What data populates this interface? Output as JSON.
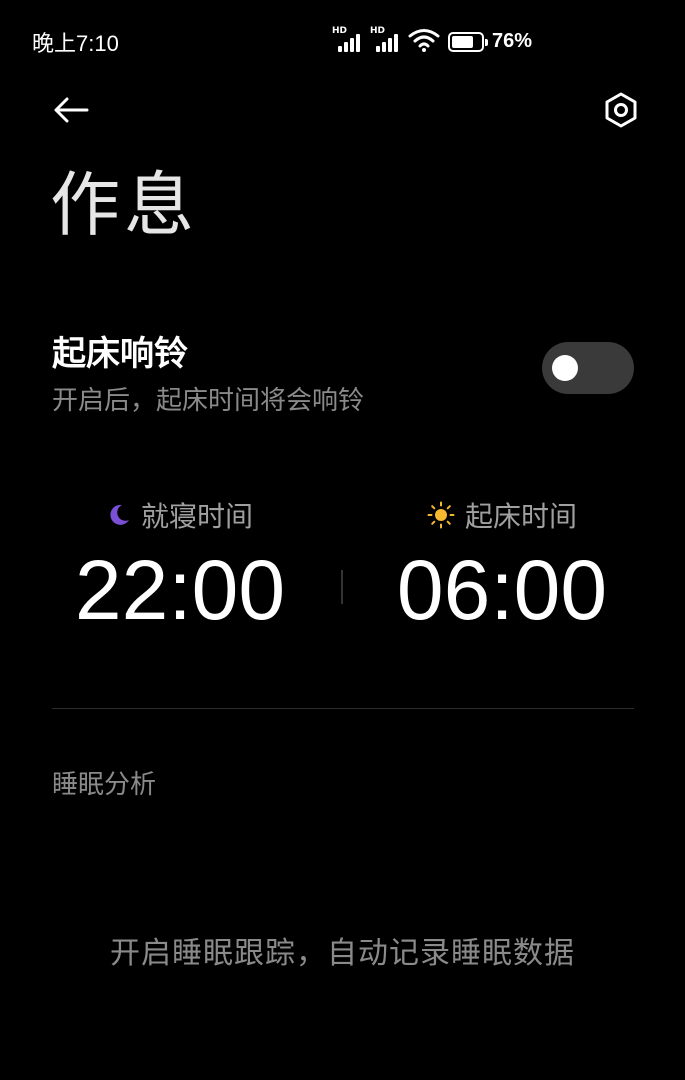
{
  "status_bar": {
    "time": "晚上7:10",
    "signal_1_label": "HD",
    "signal_2_label": "HD",
    "battery_percent": 76,
    "battery_text": "76%"
  },
  "header": {
    "back_icon": "arrow-left-icon",
    "settings_icon": "hexagon-gear-icon",
    "title": "作息"
  },
  "wake_alarm": {
    "title": "起床响铃",
    "subtitle": "开启后，起床时间将会响铃",
    "enabled": false
  },
  "schedule": {
    "bedtime": {
      "icon": "moon-icon",
      "label": "就寝时间",
      "time": "22:00"
    },
    "wake": {
      "icon": "sun-icon",
      "label": "起床时间",
      "time": "06:00"
    }
  },
  "sleep_analysis": {
    "title": "睡眠分析",
    "empty_hint": "开启睡眠跟踪，自动记录睡眠数据"
  },
  "colors": {
    "background": "#000000",
    "moon": "#7b4fd6",
    "sun": "#f5b82e",
    "toggle_off": "#3a3a3a",
    "secondary_text": "#8a8a8a"
  }
}
